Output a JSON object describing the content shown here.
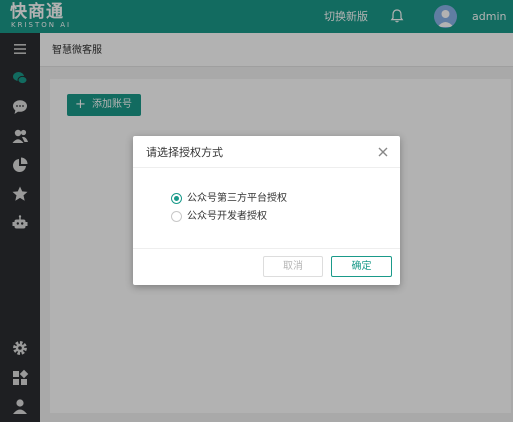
{
  "header": {
    "logo_text": "快商通",
    "logo_subtext": "KRISTON AI",
    "switch_version": "切换新版",
    "username": "admin"
  },
  "sidebar": {
    "icons": [
      "menu-icon",
      "wechat-icon",
      "chat-icon",
      "users-icon",
      "pie-chart-icon",
      "star-icon",
      "robot-icon",
      "gear-icon",
      "apps-icon",
      "user-icon"
    ]
  },
  "main": {
    "breadcrumb": "智慧微客服",
    "add_account_button": "添加账号"
  },
  "modal": {
    "title": "请选择授权方式",
    "options": [
      {
        "label": "公众号第三方平台授权",
        "selected": true
      },
      {
        "label": "公众号开发者授权",
        "selected": false
      }
    ],
    "cancel_label": "取消",
    "confirm_label": "确定"
  },
  "colors": {
    "accent": "#1a9a8a",
    "sidebar_bg": "#2b2d31"
  }
}
